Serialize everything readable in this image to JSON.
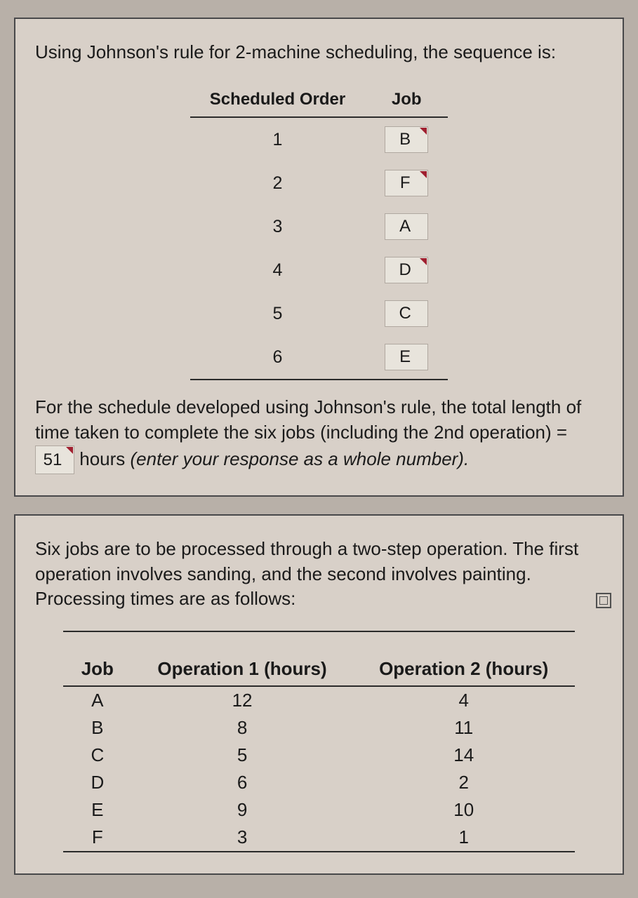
{
  "panel1": {
    "prompt": "Using Johnson's rule for 2-machine scheduling, the sequence is:",
    "seq_table": {
      "headers": [
        "Scheduled Order",
        "Job"
      ],
      "rows": [
        {
          "order": "1",
          "job": "B",
          "marker": true
        },
        {
          "order": "2",
          "job": "F",
          "marker": true
        },
        {
          "order": "3",
          "job": "A",
          "marker": false
        },
        {
          "order": "4",
          "job": "D",
          "marker": true
        },
        {
          "order": "5",
          "job": "C",
          "marker": false
        },
        {
          "order": "6",
          "job": "E",
          "marker": false
        }
      ]
    },
    "followup_before": "For the schedule developed using Johnson's rule, the total length of time taken to complete the six jobs (including the 2nd operation) = ",
    "followup_value": "51",
    "followup_after": " hours ",
    "followup_italic": "(enter your response as a whole number)."
  },
  "panel2": {
    "prompt": "Six jobs are to be processed through a two-step operation. The first operation involves sanding, and the second involves painting. Processing times are as follows:",
    "data_table": {
      "headers": [
        "Job",
        "Operation 1 (hours)",
        "Operation 2 (hours)"
      ],
      "rows": [
        {
          "job": "A",
          "op1": "12",
          "op2": "4"
        },
        {
          "job": "B",
          "op1": "8",
          "op2": "11"
        },
        {
          "job": "C",
          "op1": "5",
          "op2": "14"
        },
        {
          "job": "D",
          "op1": "6",
          "op2": "2"
        },
        {
          "job": "E",
          "op1": "9",
          "op2": "10"
        },
        {
          "job": "F",
          "op1": "3",
          "op2": "1"
        }
      ]
    }
  }
}
